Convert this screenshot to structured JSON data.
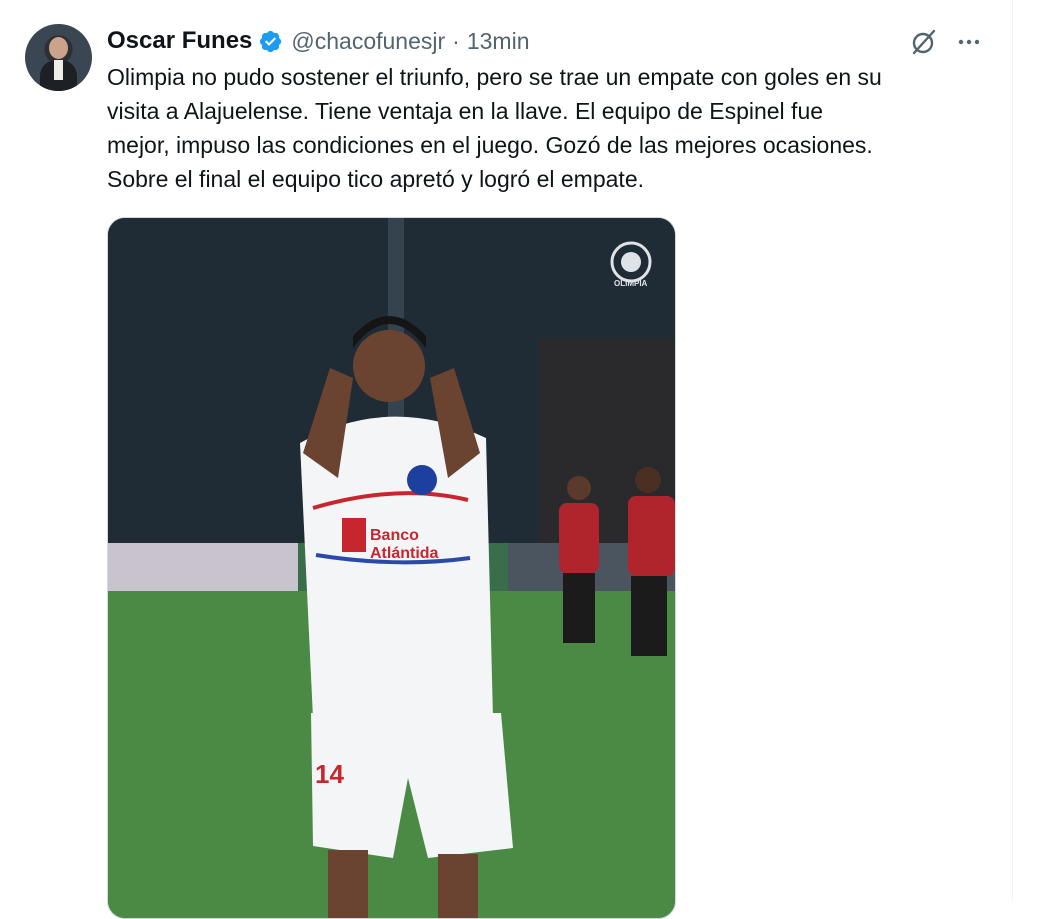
{
  "tweet": {
    "author_name": "Oscar Funes",
    "handle": "@chacofunesjr",
    "separator": "·",
    "time": "13min",
    "text": "Olimpia no pudo sostener el triunfo, pero se trae un empate con goles en su\nvisita a Alajuelense. Tiene ventaja en la llave. El equipo de Espinel fue\nmejor, impuso las condiciones en el juego. Gozó de las mejores ocasiones.\nSobre el final el equipo tico apretó y logró el empate.",
    "media": {
      "shirt_sponsor_line1": "Banco",
      "shirt_sponsor_line2": "Atlántida",
      "shorts_number": "14",
      "club_badge_text": "OLIMPIA"
    }
  },
  "icons": {
    "verified": "verified-badge-icon",
    "grok": "grok-icon",
    "more": "more-options-icon"
  },
  "colors": {
    "verified_blue": "#1d9bf0",
    "secondary_text": "#536471",
    "primary_text": "#0f1419"
  }
}
